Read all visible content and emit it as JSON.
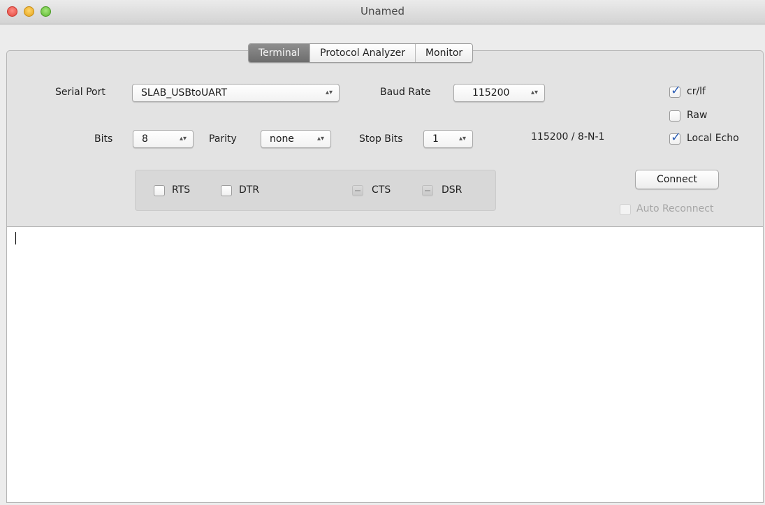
{
  "window": {
    "title": "Unamed"
  },
  "tabs": [
    {
      "label": "Terminal",
      "active": true
    },
    {
      "label": "Protocol Analyzer",
      "active": false
    },
    {
      "label": "Monitor",
      "active": false
    }
  ],
  "serial_port": {
    "label": "Serial Port",
    "value": "SLAB_USBtoUART"
  },
  "baud_rate": {
    "label": "Baud Rate",
    "value": "115200"
  },
  "bits": {
    "label": "Bits",
    "value": "8"
  },
  "parity": {
    "label": "Parity",
    "value": "none"
  },
  "stop_bits": {
    "label": "Stop Bits",
    "value": "1"
  },
  "summary": "115200 / 8-N-1",
  "options": {
    "crlf": {
      "label": "cr/lf",
      "checked": true
    },
    "raw": {
      "label": "Raw",
      "checked": false
    },
    "local_echo": {
      "label": "Local Echo",
      "checked": true
    }
  },
  "signals": {
    "rts": {
      "label": "RTS",
      "checked": false
    },
    "dtr": {
      "label": "DTR",
      "checked": false
    },
    "cts": {
      "label": "CTS"
    },
    "dsr": {
      "label": "DSR"
    }
  },
  "connect_button": {
    "label": "Connect"
  },
  "auto_reconnect": {
    "label": "Auto Reconnect",
    "checked": false,
    "enabled": false
  },
  "colors": {
    "accent_check": "#2d5fb6",
    "active_tab": "#7a7a7a"
  }
}
